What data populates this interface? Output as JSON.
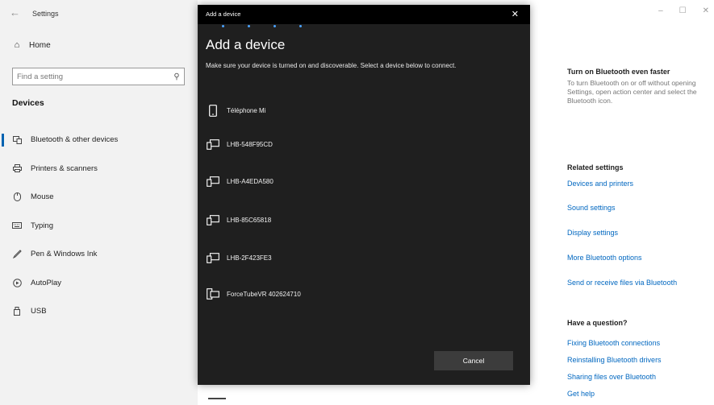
{
  "window": {
    "title": "Settings",
    "controls": [
      "–",
      "☐",
      "✕"
    ]
  },
  "sidebar": {
    "home_label": "Home",
    "search_placeholder": "Find a setting",
    "section_heading": "Devices",
    "items": [
      {
        "label": "Bluetooth & other devices",
        "icon": "bluetooth-devices-icon",
        "active": true
      },
      {
        "label": "Printers & scanners",
        "icon": "printer-icon",
        "active": false
      },
      {
        "label": "Mouse",
        "icon": "mouse-icon",
        "active": false
      },
      {
        "label": "Typing",
        "icon": "keyboard-icon",
        "active": false
      },
      {
        "label": "Pen & Windows Ink",
        "icon": "pen-icon",
        "active": false
      },
      {
        "label": "AutoPlay",
        "icon": "autoplay-icon",
        "active": false
      },
      {
        "label": "USB",
        "icon": "usb-icon",
        "active": false
      }
    ]
  },
  "dialog": {
    "titlebar": "Add a device",
    "heading": "Add a device",
    "description": "Make sure your device is turned on and discoverable. Select a device below to connect.",
    "devices": [
      {
        "name": "Téléphone Mi",
        "icon": "phone-icon"
      },
      {
        "name": "LHB-548F95CD",
        "icon": "display-device-icon"
      },
      {
        "name": "LHB-A4EDA580",
        "icon": "display-device-icon"
      },
      {
        "name": "LHB-85C65818",
        "icon": "display-device-icon"
      },
      {
        "name": "LHB-2F423FE3",
        "icon": "display-device-icon"
      },
      {
        "name": "ForceTubeVR 402624710",
        "icon": "device-combo-icon"
      }
    ],
    "cancel_label": "Cancel"
  },
  "right": {
    "bt_heading": "Turn on Bluetooth even faster",
    "bt_text": "To turn Bluetooth on or off without opening Settings, open action center and select the Bluetooth icon.",
    "related_heading": "Related settings",
    "related_links": [
      "Devices and printers",
      "Sound settings",
      "Display settings",
      "More Bluetooth options",
      "Send or receive files via Bluetooth"
    ],
    "question_heading": "Have a question?",
    "question_links": [
      "Fixing Bluetooth connections",
      "Reinstalling Bluetooth drivers",
      "Sharing files over Bluetooth",
      "Get help"
    ]
  },
  "colors": {
    "accent": "#0063b1",
    "link": "#0067c0",
    "dialog_bg": "#1f1f1f",
    "sidebar_bg": "#f2f2f2"
  }
}
